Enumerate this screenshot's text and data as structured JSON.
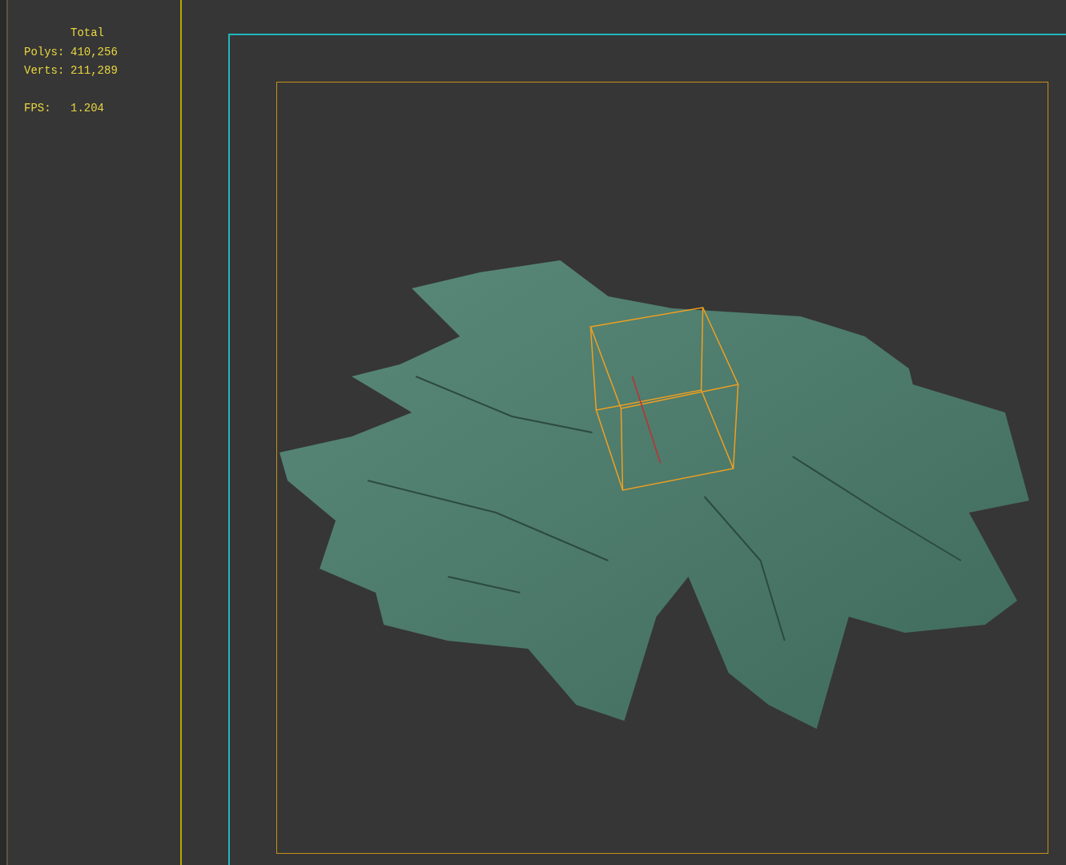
{
  "viewport": {
    "stats": {
      "heading": "Total",
      "rows": [
        {
          "label": "Polys:",
          "value": "410,256"
        },
        {
          "label": "Verts:",
          "value": "211,289"
        }
      ],
      "fps": {
        "label": "FPS:",
        "value": "1.204"
      }
    }
  }
}
